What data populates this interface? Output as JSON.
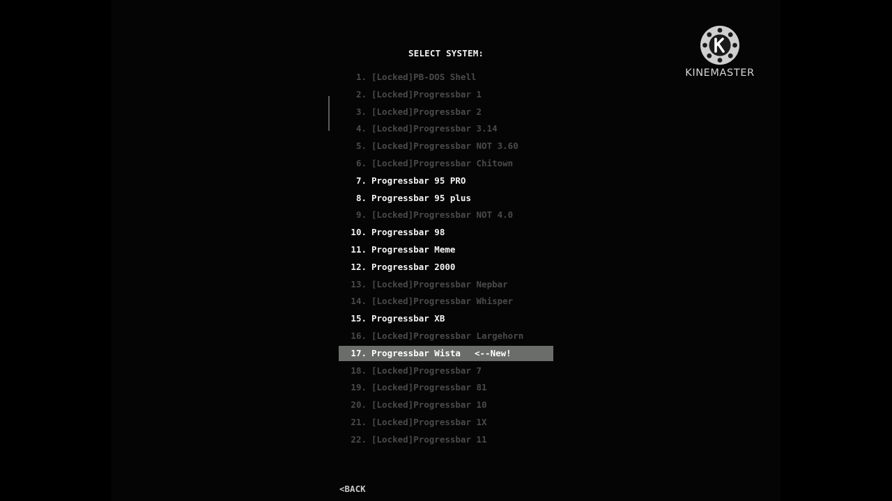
{
  "screen": {
    "title": "SELECT SYSTEM:",
    "items": [
      {
        "number": "1.",
        "label": "[Locked]PB-DOS Shell",
        "locked": true
      },
      {
        "number": "2.",
        "label": "[Locked]Progressbar 1",
        "locked": true
      },
      {
        "number": "3.",
        "label": "[Locked]Progressbar 2",
        "locked": true
      },
      {
        "number": "4.",
        "label": "[Locked]Progressbar 3.14",
        "locked": true
      },
      {
        "number": "5.",
        "label": "[Locked]Progressbar NOT 3.60",
        "locked": true
      },
      {
        "number": "6.",
        "label": "[Locked]Progressbar Chitown",
        "locked": true
      },
      {
        "number": "7.",
        "label": "Progressbar 95 PRO",
        "locked": false
      },
      {
        "number": "8.",
        "label": "Progressbar 95 plus",
        "locked": false
      },
      {
        "number": "9.",
        "label": "[Locked]Progressbar NOT 4.0",
        "locked": true
      },
      {
        "number": "10.",
        "label": "Progressbar 98",
        "locked": false
      },
      {
        "number": "11.",
        "label": "Progressbar Meme",
        "locked": false
      },
      {
        "number": "12.",
        "label": "Progressbar 2000",
        "locked": false
      },
      {
        "number": "13.",
        "label": "[Locked]Progressbar Nepbar",
        "locked": true
      },
      {
        "number": "14.",
        "label": "[Locked]Progressbar Whisper",
        "locked": true
      },
      {
        "number": "15.",
        "label": "Progressbar XB",
        "locked": false
      },
      {
        "number": "16.",
        "label": "[Locked]Progressbar Largehorn",
        "locked": true
      },
      {
        "number": "17.",
        "label": "Progressbar Wista",
        "locked": false,
        "selected": true,
        "tag": "<--New!"
      },
      {
        "number": "18.",
        "label": "[Locked]Progressbar 7",
        "locked": true
      },
      {
        "number": "19.",
        "label": "[Locked]Progressbar 81",
        "locked": true
      },
      {
        "number": "20.",
        "label": "[Locked]Progressbar 10",
        "locked": true
      },
      {
        "number": "21.",
        "label": "[Locked]Progressbar 1X",
        "locked": true
      },
      {
        "number": "22.",
        "label": "[Locked]Progressbar 11",
        "locked": true
      }
    ],
    "back_label": "<BACK"
  },
  "watermark": {
    "brand": "KINEMASTER",
    "icon": "kinemaster-logo-icon"
  },
  "colors": {
    "background": "#000000",
    "locked_text": "#4a4a4a",
    "unlocked_text": "#f5f5f5",
    "selection": "#6a6d69"
  }
}
